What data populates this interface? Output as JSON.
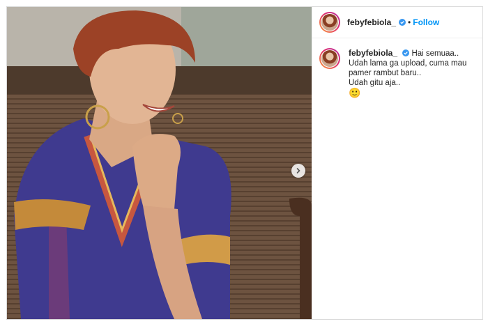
{
  "post": {
    "username": "febyfebiola_",
    "follow_label": "Follow",
    "separator": "•",
    "caption_first": "Hai semuaa..",
    "caption_lines": [
      "Udah lama ga upload, cuma mau",
      "pamer rambut baru..",
      "Udah gitu aja.."
    ],
    "emoji": "🙂"
  },
  "icons": {
    "verified": "verified-badge-icon",
    "next": "chevron-right-icon"
  },
  "colors": {
    "link": "#0095f6",
    "verified": "#3897f0",
    "text": "#262626"
  }
}
